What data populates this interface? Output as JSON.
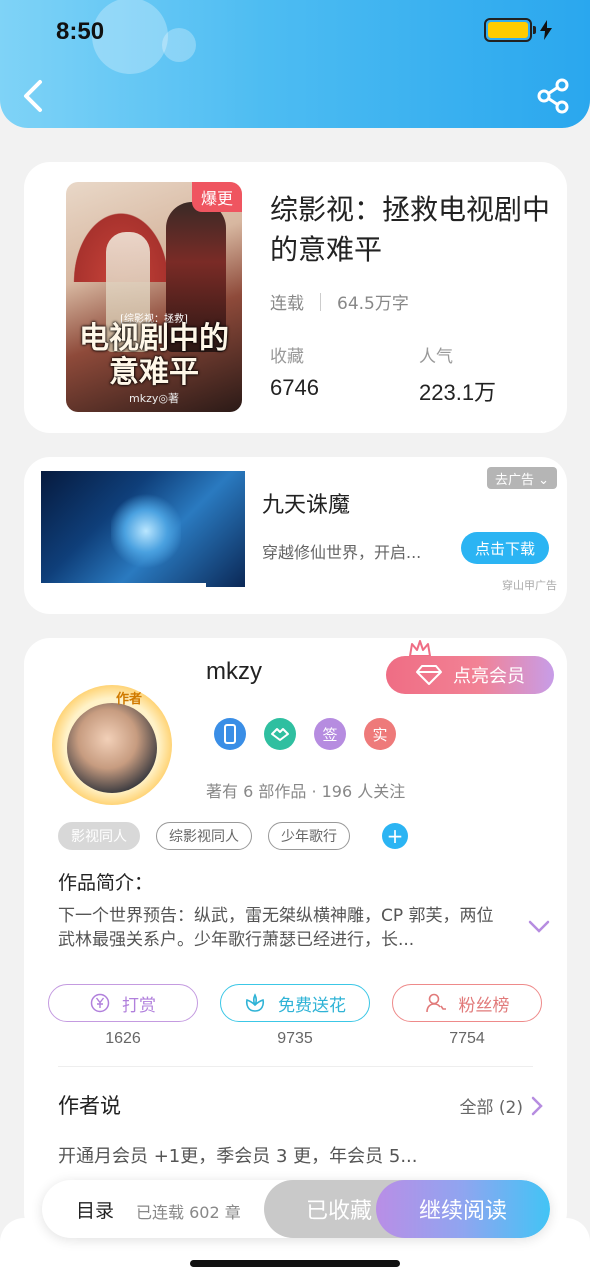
{
  "status_bar": {
    "time": "8:50"
  },
  "book": {
    "title": "综影视：拯救电视剧中的意难平",
    "cover_title": "电视剧中的意难平",
    "cover_subtitle": "[综影视：拯救]",
    "cover_author": "mkzy◎著",
    "hot_tag": "爆更",
    "status": "连载",
    "word_count": "64.5万字",
    "collect_label": "收藏",
    "collect_value": "6746",
    "popularity_label": "人气",
    "popularity_value": "223.1万"
  },
  "ad": {
    "tag": "去广告 ⌄",
    "title": "九天诛魔",
    "desc": "穿越修仙世界，开启...",
    "button": "点击下载",
    "source": "穿山甲广告"
  },
  "author": {
    "name": "mkzy",
    "avatar_badge": "作者",
    "member_button": "点亮会员",
    "badges": [
      "phone-badge",
      "handshake-badge",
      "签",
      "实"
    ],
    "works": "著有 6 部作品 · 196 人关注",
    "tags": [
      "影视同人",
      "综影视同人",
      "少年歌行"
    ],
    "intro_label": "作品简介：",
    "intro_text": "下一个世界预告：纵武，雷无桀纵横神雕，CP 郭芙，两位武林最强关系户。少年歌行萧瑟已经进行，长...",
    "actions": [
      {
        "label": "打赏",
        "count": "1626",
        "color": "#c49be0",
        "icon": "yen-icon"
      },
      {
        "label": "免费送花",
        "count": "9735",
        "color": "#3cc7e6",
        "icon": "flower-icon"
      },
      {
        "label": "粉丝榜",
        "count": "7754",
        "color": "#ee8a8a",
        "icon": "fans-icon"
      }
    ],
    "says_label": "作者说",
    "says_all": "全部 (2)",
    "says_text": "开通月会员 +1更，季会员 3 更，年会员 5..."
  },
  "bottom_bar": {
    "toc": "目录",
    "chapter_count": "已连载 602 章",
    "collected": "已收藏",
    "continue": "继续阅读"
  },
  "colors": {
    "accent": "#2bb4f3",
    "header": "#4dbcf2"
  }
}
